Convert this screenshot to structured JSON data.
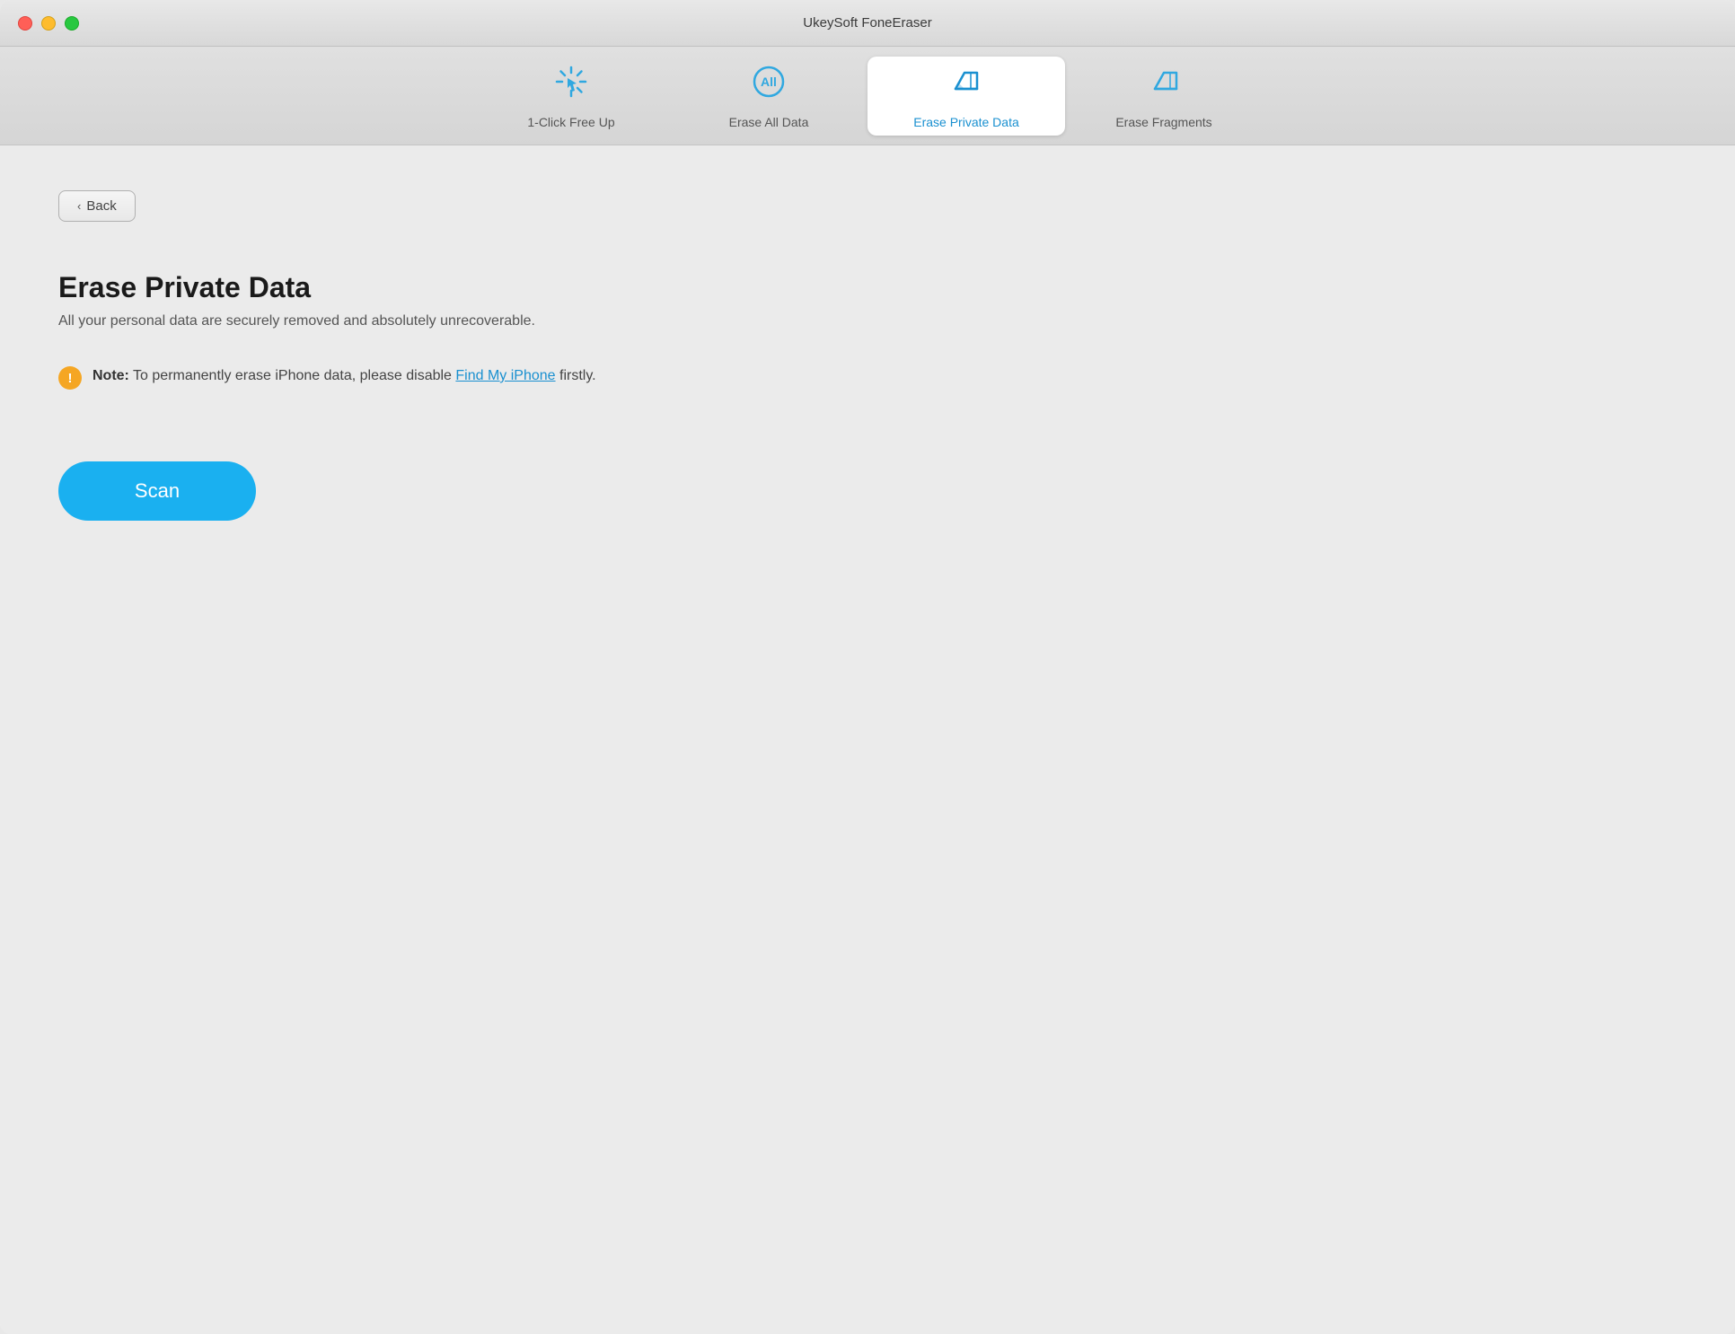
{
  "window": {
    "title": "UkeySoft FoneEraser"
  },
  "tabs": [
    {
      "id": "one-click",
      "label": "1-Click Free Up",
      "active": false
    },
    {
      "id": "erase-all",
      "label": "Erase All Data",
      "active": false
    },
    {
      "id": "erase-private",
      "label": "Erase Private Data",
      "active": true
    },
    {
      "id": "erase-fragments",
      "label": "Erase Fragments",
      "active": false
    }
  ],
  "back_button": {
    "label": "Back"
  },
  "content": {
    "title": "Erase Private Data",
    "subtitle": "All your personal data are securely removed and absolutely unrecoverable.",
    "note_label": "Note:",
    "note_text": "To permanently erase iPhone data, please disable ",
    "note_link": "Find My iPhone",
    "note_suffix": " firstly."
  },
  "scan_button": {
    "label": "Scan"
  },
  "colors": {
    "blue": "#1ab0f0",
    "orange": "#f5a623",
    "active_tab_bg": "#ffffff"
  }
}
